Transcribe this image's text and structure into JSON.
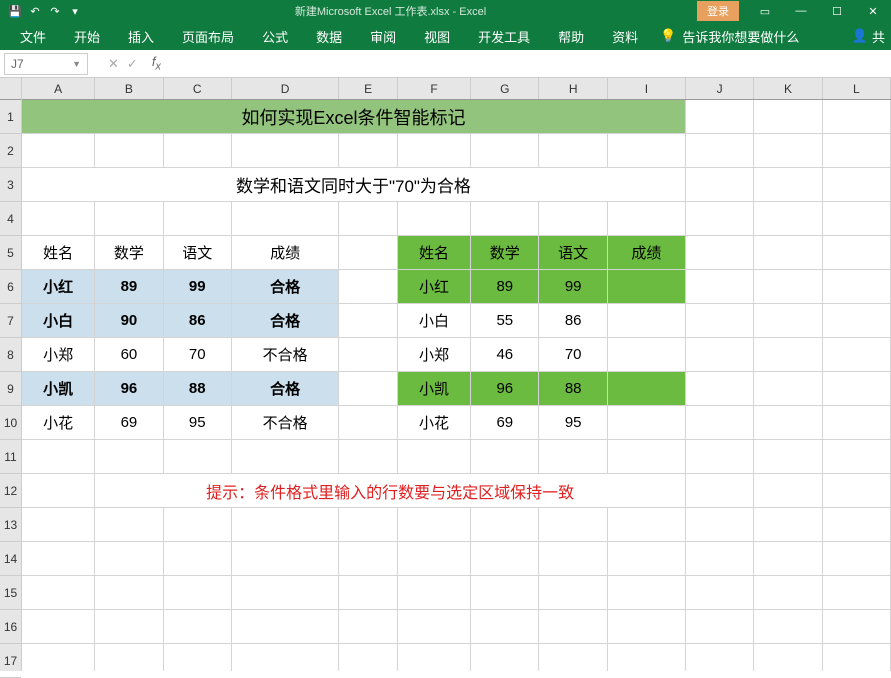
{
  "titlebar": {
    "title": "新建Microsoft Excel 工作表.xlsx - Excel",
    "login": "登录"
  },
  "ribbon": {
    "tabs": [
      "文件",
      "开始",
      "插入",
      "页面布局",
      "公式",
      "数据",
      "审阅",
      "视图",
      "开发工具",
      "帮助",
      "资料"
    ],
    "tell": "告诉我你想要做什么",
    "share": "共"
  },
  "namebox": "J7",
  "colheads": [
    "A",
    "B",
    "C",
    "D",
    "E",
    "F",
    "G",
    "H",
    "I",
    "J",
    "K",
    "L"
  ],
  "rowheads": [
    "1",
    "2",
    "3",
    "4",
    "5",
    "6",
    "7",
    "8",
    "9",
    "10",
    "11",
    "12",
    "13",
    "14",
    "15",
    "16",
    "17"
  ],
  "cells": {
    "title": "如何实现Excel条件智能标记",
    "subtitle": "数学和语文同时大于\"70\"为合格",
    "left_headers": [
      "姓名",
      "数学",
      "语文",
      "成绩"
    ],
    "right_headers": [
      "姓名",
      "数学",
      "语文",
      "成绩"
    ],
    "left_rows": [
      {
        "name": "小红",
        "math": "89",
        "chinese": "99",
        "result": "合格",
        "hl": true
      },
      {
        "name": "小白",
        "math": "90",
        "chinese": "86",
        "result": "合格",
        "hl": true
      },
      {
        "name": "小郑",
        "math": "60",
        "chinese": "70",
        "result": "不合格",
        "hl": false
      },
      {
        "name": "小凯",
        "math": "96",
        "chinese": "88",
        "result": "合格",
        "hl": true
      },
      {
        "name": "小花",
        "math": "69",
        "chinese": "95",
        "result": "不合格",
        "hl": false
      }
    ],
    "right_rows": [
      {
        "name": "小红",
        "math": "89",
        "chinese": "99",
        "hl": true
      },
      {
        "name": "小白",
        "math": "55",
        "chinese": "86",
        "hl": false
      },
      {
        "name": "小郑",
        "math": "46",
        "chinese": "70",
        "hl": false
      },
      {
        "name": "小凯",
        "math": "96",
        "chinese": "88",
        "hl": true
      },
      {
        "name": "小花",
        "math": "69",
        "chinese": "95",
        "hl": false
      }
    ],
    "tip": "提示：条件格式里输入的行数要与选定区域保持一致"
  },
  "colwidths": {
    "A": 75,
    "B": 70,
    "C": 70,
    "D": 110,
    "E": 60,
    "F": 75,
    "G": 70,
    "H": 70,
    "I": 80,
    "J": 70,
    "K": 70,
    "L": 70
  },
  "chart_data": {
    "type": "table",
    "title": "如何实现Excel条件智能标记",
    "note": "数学和语文同时大于\"70\"为合格",
    "tables": [
      {
        "columns": [
          "姓名",
          "数学",
          "语文",
          "成绩"
        ],
        "rows": [
          [
            "小红",
            89,
            99,
            "合格"
          ],
          [
            "小白",
            90,
            86,
            "合格"
          ],
          [
            "小郑",
            60,
            70,
            "不合格"
          ],
          [
            "小凯",
            96,
            88,
            "合格"
          ],
          [
            "小花",
            69,
            95,
            "不合格"
          ]
        ]
      },
      {
        "columns": [
          "姓名",
          "数学",
          "语文",
          "成绩"
        ],
        "rows": [
          [
            "小红",
            89,
            99,
            null
          ],
          [
            "小白",
            55,
            86,
            null
          ],
          [
            "小郑",
            46,
            70,
            null
          ],
          [
            "小凯",
            96,
            88,
            null
          ],
          [
            "小花",
            69,
            95,
            null
          ]
        ]
      }
    ]
  }
}
